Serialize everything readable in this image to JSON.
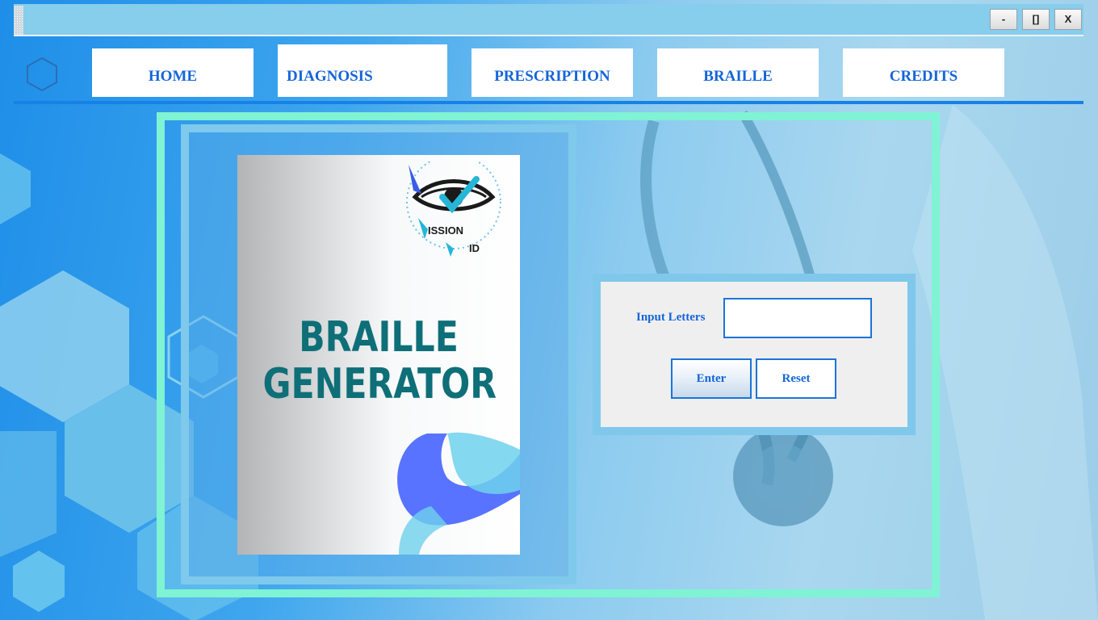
{
  "window": {
    "minimize_label": "-",
    "maximize_label": "[]",
    "close_label": "X"
  },
  "nav": {
    "home": "HOME",
    "diagnosis": "DIAGNOSIS",
    "prescription": "PRESCRIPTION",
    "braille": "BRAILLE",
    "credits": "CREDITS"
  },
  "poster": {
    "logo_word1": "ISSION",
    "logo_word2": "ID",
    "title_line1": "BRAILLE",
    "title_line2": "GENERATOR"
  },
  "form": {
    "input_label": "Input Letters",
    "input_value": "",
    "enter_label": "Enter",
    "reset_label": "Reset"
  },
  "colors": {
    "accent": "#1565d8",
    "frame": "#7ff3d3",
    "poster_title": "#0e6f78"
  },
  "icons": {
    "logo": "hexagon-icon",
    "poster_logo": "eye-check-icon"
  }
}
